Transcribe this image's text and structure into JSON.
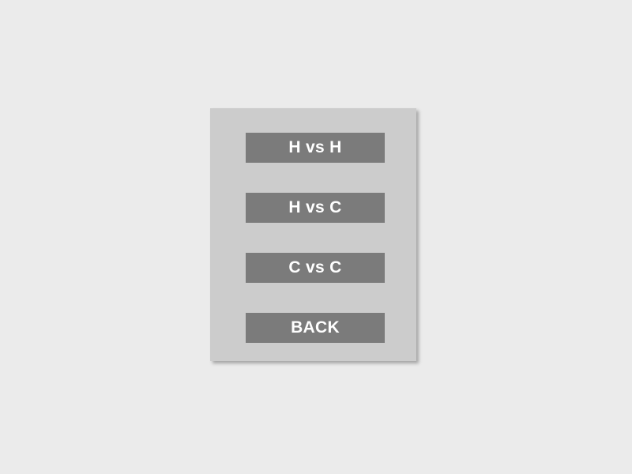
{
  "menu": {
    "buttons": [
      {
        "label": "H vs H"
      },
      {
        "label": "H vs C"
      },
      {
        "label": "C vs C"
      },
      {
        "label": "BACK"
      }
    ]
  },
  "colors": {
    "background": "#ebebeb",
    "panel": "#cccccc",
    "button": "#7b7b7b",
    "button_text": "#ffffff"
  }
}
